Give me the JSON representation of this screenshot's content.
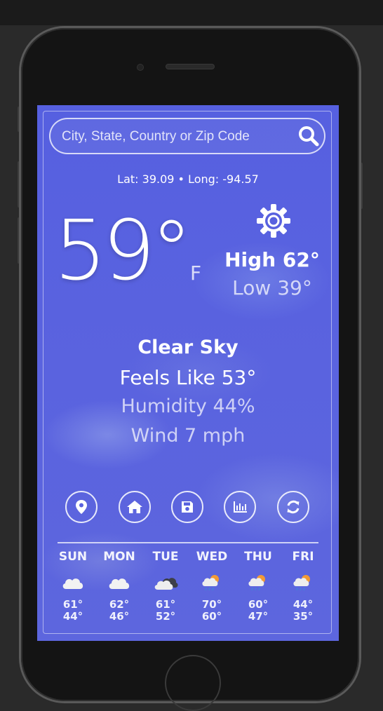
{
  "search": {
    "placeholder": "City, State, Country or Zip Code"
  },
  "location": {
    "coords": "Lat: 39.09 • Long: -94.57"
  },
  "current": {
    "temperature": "59°",
    "unit": "F",
    "high": "High 62°",
    "low": "Low 39°",
    "condition": "Clear Sky",
    "feels_like": "Feels Like 53°",
    "humidity": "Humidity 44%",
    "wind": "Wind 7 mph"
  },
  "controls": [
    "location-icon",
    "home-icon",
    "save-icon",
    "chart-icon",
    "refresh-icon"
  ],
  "forecast": [
    {
      "day": "SUN",
      "icon": "cloud-icon",
      "high": "61°",
      "low": "44°"
    },
    {
      "day": "MON",
      "icon": "cloud-icon",
      "high": "62°",
      "low": "46°"
    },
    {
      "day": "TUE",
      "icon": "dark-cloud-icon",
      "high": "61°",
      "low": "52°"
    },
    {
      "day": "WED",
      "icon": "sun-cloud-rain-icon",
      "high": "70°",
      "low": "60°"
    },
    {
      "day": "THU",
      "icon": "sun-cloud-rain-icon",
      "high": "60°",
      "low": "47°"
    },
    {
      "day": "FRI",
      "icon": "sun-cloud-rain-icon",
      "high": "44°",
      "low": "35°"
    }
  ],
  "colors": {
    "background": "#5660e0",
    "accent": "#ffffff",
    "sun": "#f39a35",
    "rain": "#4a7bd9"
  }
}
